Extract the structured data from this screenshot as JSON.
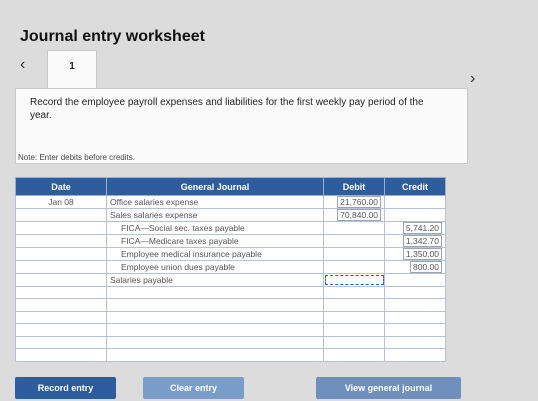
{
  "header": {
    "title": "Journal entry worksheet"
  },
  "nav": {
    "prev_icon": "chevron-left-icon",
    "next_icon": "chevron-right-icon",
    "tab_number": "1"
  },
  "instructions": {
    "text": "Record the employee payroll expenses and liabilities for the first weekly pay period of the year.",
    "note": "Note: Enter debits before credits."
  },
  "journal": {
    "columns": {
      "date": "Date",
      "account": "General Journal",
      "debit": "Debit",
      "credit": "Credit"
    },
    "rows": [
      {
        "date": "Jan 08",
        "account": "Office salaries expense",
        "debit": "21,760.00",
        "credit": "",
        "indent": false
      },
      {
        "date": "",
        "account": "Sales salaries expense",
        "debit": "70,840.00",
        "credit": "",
        "indent": false
      },
      {
        "date": "",
        "account": "FICA—Social sec. taxes payable",
        "debit": "",
        "credit": "5,741.20",
        "indent": true
      },
      {
        "date": "",
        "account": "FICA—Medicare taxes payable",
        "debit": "",
        "credit": "1,342.70",
        "indent": true
      },
      {
        "date": "",
        "account": "Employee medical insurance payable",
        "debit": "",
        "credit": "1,350.00",
        "indent": true
      },
      {
        "date": "",
        "account": "Employee union dues payable",
        "debit": "",
        "credit": "800.00",
        "indent": true
      },
      {
        "date": "",
        "account": "Salaries payable",
        "debit": "",
        "credit": "",
        "indent": false
      },
      {
        "date": "",
        "account": "",
        "debit": "",
        "credit": "",
        "indent": false
      },
      {
        "date": "",
        "account": "",
        "debit": "",
        "credit": "",
        "indent": false
      },
      {
        "date": "",
        "account": "",
        "debit": "",
        "credit": "",
        "indent": false
      },
      {
        "date": "",
        "account": "",
        "debit": "",
        "credit": "",
        "indent": false
      },
      {
        "date": "",
        "account": "",
        "debit": "",
        "credit": "",
        "indent": false
      },
      {
        "date": "",
        "account": "",
        "debit": "",
        "credit": "",
        "indent": false
      }
    ]
  },
  "buttons": {
    "record": "Record entry",
    "clear": "Clear entry",
    "view": "View general journal"
  }
}
